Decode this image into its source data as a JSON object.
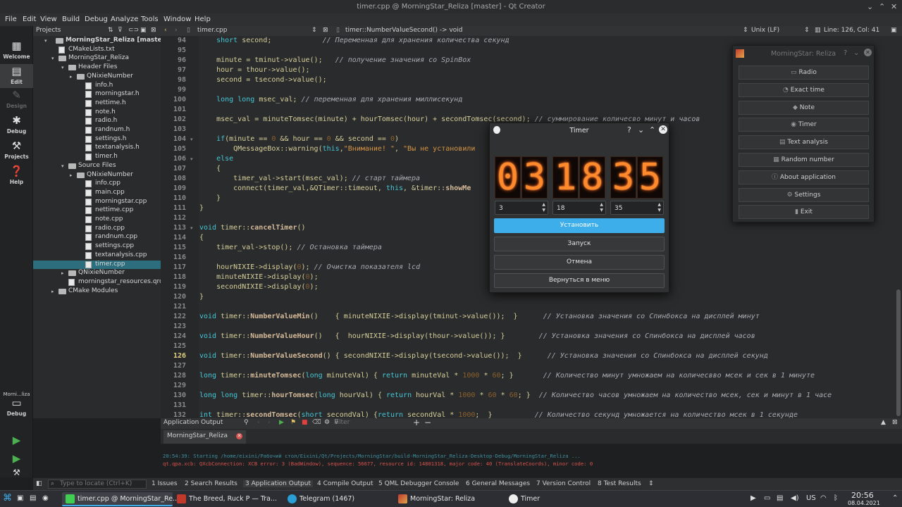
{
  "window": {
    "title": "timer.cpp @ MorningStar_Reliza [master] - Qt Creator"
  },
  "menubar": [
    "File",
    "Edit",
    "View",
    "Build",
    "Debug",
    "Analyze",
    "Tools",
    "Window",
    "Help"
  ],
  "modes": {
    "welcome": "Welcome",
    "edit": "Edit",
    "design": "Design",
    "debug": "Debug",
    "projects": "Projects",
    "help": "Help",
    "kit": "Morni...liza",
    "kit_mode": "Debug"
  },
  "projects": {
    "header": "Projects",
    "tree": [
      "MorningStar_Reliza [master]",
      "CMakeLists.txt",
      "MorningStar_Reliza",
      "Header Files",
      "QNixieNumber",
      "info.h",
      "morningstar.h",
      "nettime.h",
      "note.h",
      "radio.h",
      "randnum.h",
      "settings.h",
      "textanalysis.h",
      "timer.h",
      "Source Files",
      "QNixieNumber",
      "info.cpp",
      "main.cpp",
      "morningstar.cpp",
      "nettime.cpp",
      "note.cpp",
      "radio.cpp",
      "randnum.cpp",
      "settings.cpp",
      "textanalysis.cpp",
      "timer.cpp",
      "QNixieNumber",
      "morningstar_resources.qrc",
      "CMake Modules"
    ]
  },
  "editor": {
    "file": "timer.cpp",
    "function": "timer::NumberValueSecond() -> void",
    "encoding": "Unix (LF)",
    "position": "Line: 126, Col: 41",
    "line_numbers": [
      "94",
      "95",
      "96",
      "97",
      "98",
      "99",
      "100",
      "101",
      "102",
      "103",
      "104",
      "105",
      "106",
      "107",
      "108",
      "109",
      "110",
      "111",
      "112",
      "113",
      "114",
      "115",
      "116",
      "117",
      "118",
      "119",
      "120",
      "121",
      "122",
      "123",
      "124",
      "125",
      "126",
      "127",
      "128",
      "129",
      "130",
      "131",
      "132"
    ],
    "code": [
      "    short second;            // Переменная для хранения количества секунд",
      "",
      "    minute = tminut->value();   // получение значения со SpinBox",
      "    hour = thour->value();",
      "    second = tsecond->value();",
      "",
      "    long long msec_val; // переменная для хранения миллисекунд",
      "",
      "    msec_val = minuteTomsec(minute) + hourTomsec(hour) + secondTomsec(second); // суммирование количесво минут и часов",
      "",
      "    if(minute == 0 && hour == 0 && second == 0)",
      "        QMessageBox::warning(this,\"Внимание! \", \"Вы не установили",
      "    else",
      "    {",
      "        timer_val->start(msec_val); // старт таймера",
      "        connect(timer_val,&QTimer::timeout, this, &timer::showMe",
      "    }",
      "}",
      "",
      "void timer::cancelTimer()",
      "{",
      "    timer_val->stop(); // Остановка таймера",
      "",
      "    hourNIXIE->display(0); // Очистка показателя lcd",
      "    minuteNIXIE->display(0);",
      "    secondNIXIE->display(0);",
      "}",
      "",
      "void timer::NumberValueMin()    { minuteNIXIE->display(tminut->value());  }      // Установка значения со Спинбокса на дисплей минут",
      "",
      "void timer::NumberValueHour()   {  hourNIXIE->display(thour->value()); }        // Установка значения со Спинбокса на дисплей часов",
      "",
      "void timer::NumberValueSecond() { secondNIXIE->display(tsecond->value());  }      // Установка значения со Спинбокса на дисплей секунд",
      "",
      "long timer::minuteTomsec(long minuteVal) { return minuteVal * 1000 * 60; }       // Количество минут умножаем на количесвво мсек и сек в 1 минуте",
      "",
      "long long timer::hourTomsec(long hourVal) { return hourVal * 1000 * 60 * 60; }  // Количество часов умножаем на количество мсек, сек и минут в 1 часе",
      "",
      "int timer::secondTomsec(short secondVal) {return secondVal * 1000;  }          // Количество секунд умножается на количество мсек в 1 секунде"
    ]
  },
  "output": {
    "title": "Application Output",
    "filter_placeholder": "Filter",
    "tab": "MorningStar_Reliza",
    "lines": [
      "20:54:39: Starting /home/eixini/Рабочий стол/Eixini/Qt/Projects/MorningStar/build-MorningStar_Reliza-Desktop-Debug/MorningStar_Reliza ...",
      "qt.qpa.xcb: QXcbConnection: XCB error: 3 (BadWindow), sequence: 56677, resource id: 14801318, major code: 40 (TranslateCoords), minor code: 0"
    ]
  },
  "statusbar": {
    "locate_placeholder": "Type to locate (Ctrl+K)",
    "tabs": [
      "1 Issues",
      "2 Search Results",
      "3 Application Output",
      "4 Compile Output",
      "5 QML Debugger Console",
      "6 General Messages",
      "7 Version Control",
      "8 Test Results"
    ]
  },
  "menu_window": {
    "title": "MorningStar: Reliza",
    "buttons": [
      "Radio",
      "Exact time",
      "Note",
      "Timer",
      "Text analysis",
      "Random number",
      "About application",
      "Settings",
      "Exit"
    ]
  },
  "timer_dialog": {
    "title": "Timer",
    "digits": [
      "0",
      "3",
      "1",
      "8",
      "3",
      "5"
    ],
    "hours": "3",
    "minutes": "18",
    "seconds": "35",
    "set_button": "Установить",
    "start_button": "Запуск",
    "cancel_button": "Отмена",
    "back_button": "Вернуться в меню"
  },
  "taskbar": {
    "windows": [
      "timer.cpp @ MorningStar_Re...",
      "The Breed, Ruck P — Tra...",
      "Telegram (1467)",
      "MorningStar: Reliza",
      "Timer"
    ],
    "keyboard_layout": "US",
    "time": "20:56",
    "date": "08.04.2021"
  },
  "colors": {
    "accent": "#3daee9",
    "selection": "#2d6e7e",
    "error_text": "#d9534f",
    "info_text": "#3f8fa0"
  }
}
